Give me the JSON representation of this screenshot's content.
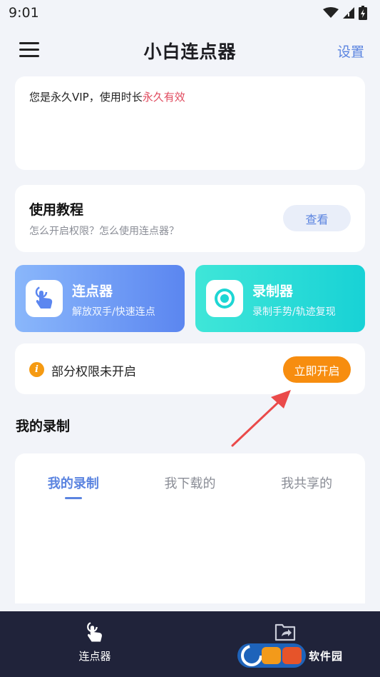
{
  "status_bar": {
    "time": "9:01"
  },
  "header": {
    "title": "小白连点器",
    "settings_label": "设置"
  },
  "vip": {
    "text": "您是永久VIP，使用时长",
    "highlight": "永久有效"
  },
  "tutorial": {
    "title": "使用教程",
    "subtitle": "怎么开启权限？怎么使用连点器？",
    "button_label": "查看"
  },
  "features": [
    {
      "title": "连点器",
      "subtitle": "解放双手/快速连点"
    },
    {
      "title": "录制器",
      "subtitle": "录制手势/轨迹复现"
    }
  ],
  "permission": {
    "text": "部分权限未开启",
    "button_label": "立即开启"
  },
  "section_title": "我的录制",
  "tabs": [
    {
      "label": "我的录制",
      "active": true
    },
    {
      "label": "我下载的",
      "active": false
    },
    {
      "label": "我共享的",
      "active": false
    }
  ],
  "bottom_nav": [
    {
      "label": "连点器",
      "icon": "tap-hand-icon"
    },
    {
      "label": "",
      "icon": "share-folder-icon"
    }
  ],
  "watermark": {
    "text": "软件园"
  },
  "colors": {
    "accent": "#5b84e0",
    "warning": "#f78d0f",
    "vip_highlight": "#e04a5e",
    "nav_background": "#20233a",
    "recorder_gradient": "#18d2d6",
    "clicker_gradient": "#5b86f0"
  }
}
